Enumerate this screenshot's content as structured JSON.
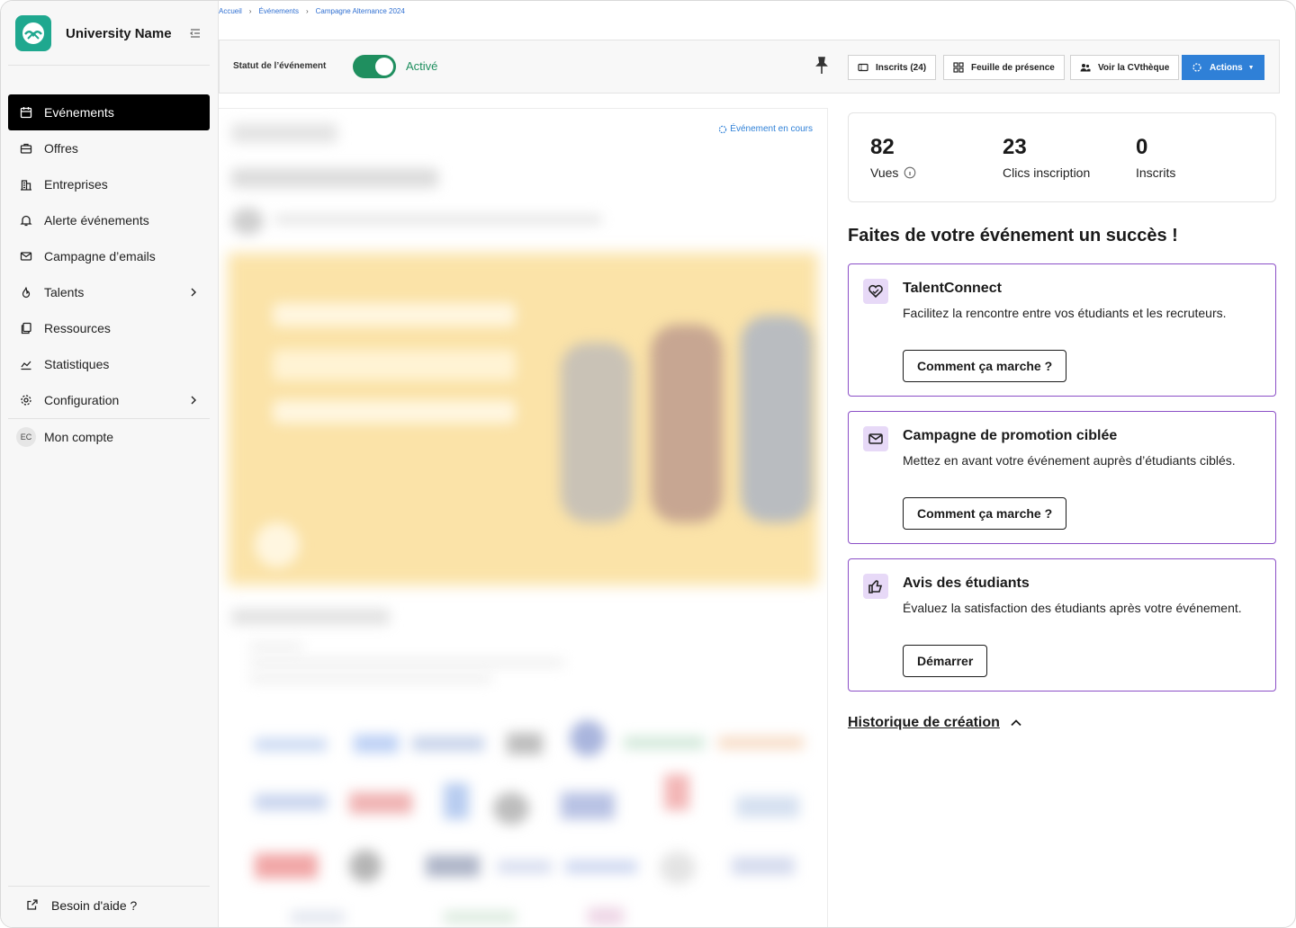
{
  "sidebar": {
    "brand_name": "University Name",
    "items": [
      {
        "label": "Evénements",
        "icon": "calendar-icon"
      },
      {
        "label": "Offres",
        "icon": "briefcase-icon"
      },
      {
        "label": "Entreprises",
        "icon": "building-icon"
      },
      {
        "label": "Alerte événements",
        "icon": "bell-icon"
      },
      {
        "label": "Campagne d’emails",
        "icon": "mail-icon"
      },
      {
        "label": "Talents",
        "icon": "flame-icon"
      },
      {
        "label": "Ressources",
        "icon": "copy-icon"
      },
      {
        "label": "Statistiques",
        "icon": "chart-icon"
      },
      {
        "label": "Configuration",
        "icon": "gear-icon"
      }
    ],
    "account": {
      "initials": "EC",
      "label": "Mon compte"
    },
    "help_label": "Besoin d'aide ?"
  },
  "breadcrumb": [
    "Accueil",
    "Événements",
    "Campagne Alternance 2024"
  ],
  "statusbar": {
    "label": "Statut de l’événement",
    "value": "Activé",
    "buttons": {
      "inscrits": "Inscrits (24)",
      "presence": "Feuille de présence",
      "cvtheque": "Voir la CVthèque",
      "actions": "Actions"
    }
  },
  "preview": {
    "status": "Événement en cours"
  },
  "stats": [
    {
      "value": "82",
      "label": "Vues"
    },
    {
      "value": "23",
      "label": "Clics inscription"
    },
    {
      "value": "0",
      "label": "Inscrits"
    }
  ],
  "promo": {
    "title": "Faites de votre événement un succès !",
    "cards": [
      {
        "title": "TalentConnect",
        "desc": "Facilitez la rencontre entre vos étudiants et les recruteurs.",
        "button": "Comment ça marche ?"
      },
      {
        "title": "Campagne de promotion ciblée",
        "desc": "Mettez en avant votre événement auprès d’étudiants ciblés.",
        "button": "Comment ça marche ?"
      },
      {
        "title": "Avis des étudiants",
        "desc": "Évaluez la satisfaction des étudiants après votre événement.",
        "button": "Démarrer"
      }
    ]
  },
  "history": {
    "label": "Historique de création"
  },
  "colors": {
    "brand": "#1fa88f",
    "active_green": "#1f8f5f",
    "primary_blue": "#2f80d7",
    "promo_purple": "#8b4fc7"
  }
}
